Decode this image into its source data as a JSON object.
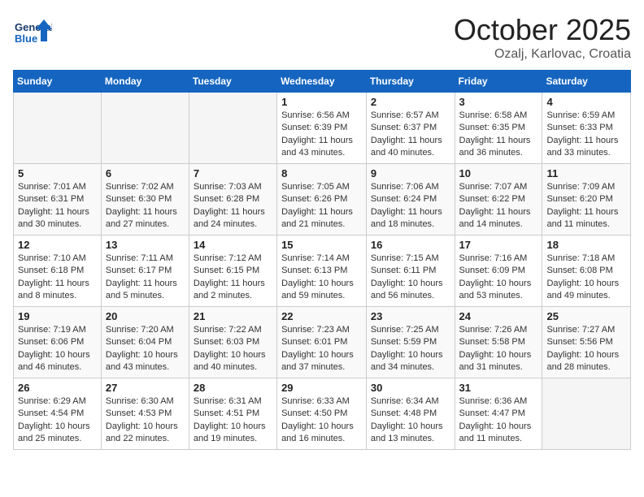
{
  "header": {
    "logo_text_general": "General",
    "logo_text_blue": "Blue",
    "month": "October 2025",
    "location": "Ozalj, Karlovac, Croatia"
  },
  "weekdays": [
    "Sunday",
    "Monday",
    "Tuesday",
    "Wednesday",
    "Thursday",
    "Friday",
    "Saturday"
  ],
  "weeks": [
    [
      {
        "day": "",
        "info": ""
      },
      {
        "day": "",
        "info": ""
      },
      {
        "day": "",
        "info": ""
      },
      {
        "day": "1",
        "info": "Sunrise: 6:56 AM\nSunset: 6:39 PM\nDaylight: 11 hours and 43 minutes."
      },
      {
        "day": "2",
        "info": "Sunrise: 6:57 AM\nSunset: 6:37 PM\nDaylight: 11 hours and 40 minutes."
      },
      {
        "day": "3",
        "info": "Sunrise: 6:58 AM\nSunset: 6:35 PM\nDaylight: 11 hours and 36 minutes."
      },
      {
        "day": "4",
        "info": "Sunrise: 6:59 AM\nSunset: 6:33 PM\nDaylight: 11 hours and 33 minutes."
      }
    ],
    [
      {
        "day": "5",
        "info": "Sunrise: 7:01 AM\nSunset: 6:31 PM\nDaylight: 11 hours and 30 minutes."
      },
      {
        "day": "6",
        "info": "Sunrise: 7:02 AM\nSunset: 6:30 PM\nDaylight: 11 hours and 27 minutes."
      },
      {
        "day": "7",
        "info": "Sunrise: 7:03 AM\nSunset: 6:28 PM\nDaylight: 11 hours and 24 minutes."
      },
      {
        "day": "8",
        "info": "Sunrise: 7:05 AM\nSunset: 6:26 PM\nDaylight: 11 hours and 21 minutes."
      },
      {
        "day": "9",
        "info": "Sunrise: 7:06 AM\nSunset: 6:24 PM\nDaylight: 11 hours and 18 minutes."
      },
      {
        "day": "10",
        "info": "Sunrise: 7:07 AM\nSunset: 6:22 PM\nDaylight: 11 hours and 14 minutes."
      },
      {
        "day": "11",
        "info": "Sunrise: 7:09 AM\nSunset: 6:20 PM\nDaylight: 11 hours and 11 minutes."
      }
    ],
    [
      {
        "day": "12",
        "info": "Sunrise: 7:10 AM\nSunset: 6:18 PM\nDaylight: 11 hours and 8 minutes."
      },
      {
        "day": "13",
        "info": "Sunrise: 7:11 AM\nSunset: 6:17 PM\nDaylight: 11 hours and 5 minutes."
      },
      {
        "day": "14",
        "info": "Sunrise: 7:12 AM\nSunset: 6:15 PM\nDaylight: 11 hours and 2 minutes."
      },
      {
        "day": "15",
        "info": "Sunrise: 7:14 AM\nSunset: 6:13 PM\nDaylight: 10 hours and 59 minutes."
      },
      {
        "day": "16",
        "info": "Sunrise: 7:15 AM\nSunset: 6:11 PM\nDaylight: 10 hours and 56 minutes."
      },
      {
        "day": "17",
        "info": "Sunrise: 7:16 AM\nSunset: 6:09 PM\nDaylight: 10 hours and 53 minutes."
      },
      {
        "day": "18",
        "info": "Sunrise: 7:18 AM\nSunset: 6:08 PM\nDaylight: 10 hours and 49 minutes."
      }
    ],
    [
      {
        "day": "19",
        "info": "Sunrise: 7:19 AM\nSunset: 6:06 PM\nDaylight: 10 hours and 46 minutes."
      },
      {
        "day": "20",
        "info": "Sunrise: 7:20 AM\nSunset: 6:04 PM\nDaylight: 10 hours and 43 minutes."
      },
      {
        "day": "21",
        "info": "Sunrise: 7:22 AM\nSunset: 6:03 PM\nDaylight: 10 hours and 40 minutes."
      },
      {
        "day": "22",
        "info": "Sunrise: 7:23 AM\nSunset: 6:01 PM\nDaylight: 10 hours and 37 minutes."
      },
      {
        "day": "23",
        "info": "Sunrise: 7:25 AM\nSunset: 5:59 PM\nDaylight: 10 hours and 34 minutes."
      },
      {
        "day": "24",
        "info": "Sunrise: 7:26 AM\nSunset: 5:58 PM\nDaylight: 10 hours and 31 minutes."
      },
      {
        "day": "25",
        "info": "Sunrise: 7:27 AM\nSunset: 5:56 PM\nDaylight: 10 hours and 28 minutes."
      }
    ],
    [
      {
        "day": "26",
        "info": "Sunrise: 6:29 AM\nSunset: 4:54 PM\nDaylight: 10 hours and 25 minutes."
      },
      {
        "day": "27",
        "info": "Sunrise: 6:30 AM\nSunset: 4:53 PM\nDaylight: 10 hours and 22 minutes."
      },
      {
        "day": "28",
        "info": "Sunrise: 6:31 AM\nSunset: 4:51 PM\nDaylight: 10 hours and 19 minutes."
      },
      {
        "day": "29",
        "info": "Sunrise: 6:33 AM\nSunset: 4:50 PM\nDaylight: 10 hours and 16 minutes."
      },
      {
        "day": "30",
        "info": "Sunrise: 6:34 AM\nSunset: 4:48 PM\nDaylight: 10 hours and 13 minutes."
      },
      {
        "day": "31",
        "info": "Sunrise: 6:36 AM\nSunset: 4:47 PM\nDaylight: 10 hours and 11 minutes."
      },
      {
        "day": "",
        "info": ""
      }
    ]
  ]
}
